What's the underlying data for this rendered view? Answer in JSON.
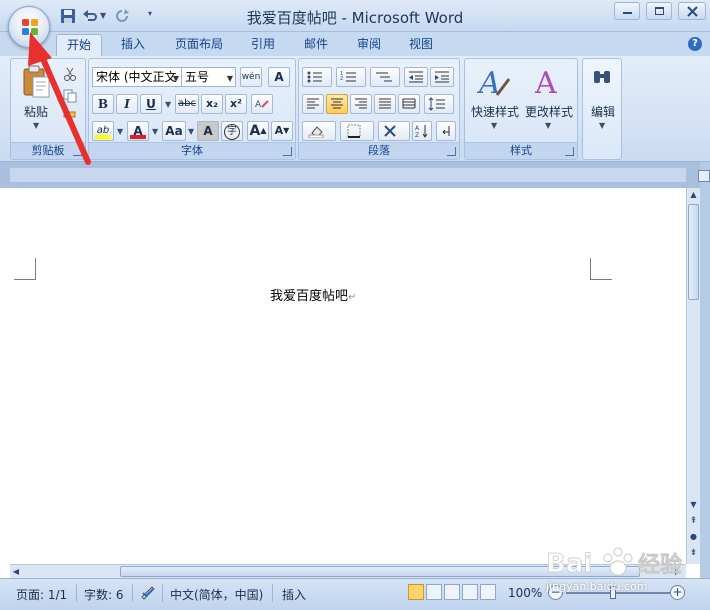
{
  "title_bar": {
    "window_title": "我爱百度帖吧 - Microsoft Word",
    "quick_access": [
      "save-icon",
      "undo-icon",
      "redo-icon",
      "customize-icon"
    ],
    "window_controls": [
      "minimize",
      "maximize",
      "close"
    ]
  },
  "tabs": [
    {
      "label": "开始",
      "active": true
    },
    {
      "label": "插入",
      "active": false
    },
    {
      "label": "页面布局",
      "active": false
    },
    {
      "label": "引用",
      "active": false
    },
    {
      "label": "邮件",
      "active": false
    },
    {
      "label": "审阅",
      "active": false
    },
    {
      "label": "视图",
      "active": false
    }
  ],
  "ribbon": {
    "clipboard": {
      "paste_label": "粘贴",
      "group_label": "剪贴板"
    },
    "font": {
      "font_name": "宋体 (中文正文",
      "font_size": "五号",
      "bold": "B",
      "italic": "I",
      "underline": "U",
      "strike": "abc",
      "subscript": "x₂",
      "superscript": "x²",
      "change_case": "Aa",
      "grow": "A",
      "shrink": "A",
      "highlight": "ab",
      "font_color": "A",
      "char_shading": "A",
      "enclose": "字",
      "phonetic": "wén",
      "group_label": "字体"
    },
    "paragraph": {
      "group_label": "段落",
      "selected_alignment": "center"
    },
    "styles": {
      "quick_styles": "快速样式",
      "change_styles": "更改样式",
      "group_label": "样式"
    },
    "editing": {
      "label": "编辑"
    }
  },
  "document": {
    "text": "我爱百度帖吧",
    "paragraph_mark": "↵"
  },
  "status_bar": {
    "page": "页面: 1/1",
    "word_count": "字数: 6",
    "language": "中文(简体，中国)",
    "mode": "插入",
    "zoom": "100%"
  },
  "watermark": {
    "text": "Bai 经验",
    "url_text": "jingyan.baidu.com"
  },
  "colors": {
    "ribbon_bg": "#dce8f6",
    "title_bar": "#c6d9f1",
    "accent_selected": "#ffc95c",
    "annotation_arrow": "#e8312f"
  }
}
